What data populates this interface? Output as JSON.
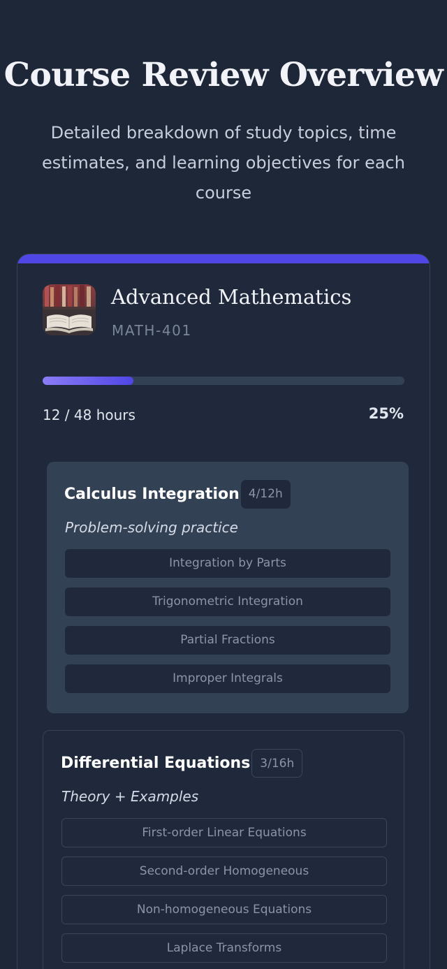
{
  "header": {
    "title": "Course Review Overview",
    "subtitle": "Detailed breakdown of study topics, time estimates, and learning objectives for each course"
  },
  "course": {
    "name": "Advanced Mathematics",
    "code": "MATH-401",
    "thumbnail_icon": "open-book-photo",
    "progress_fraction": 0.25,
    "hours_label": "12 / 48 hours",
    "percent_label": "25%",
    "accent_color": "#5046e5"
  },
  "topics": [
    {
      "title": "Calculus Integration",
      "badge": "4/12h",
      "description": "Problem-solving practice",
      "subtopics": [
        "Integration by Parts",
        "Trigonometric Integration",
        "Partial Fractions",
        "Improper Integrals"
      ]
    },
    {
      "title": "Differential Equations",
      "badge": "3/16h",
      "description": "Theory + Examples",
      "subtopics": [
        "First-order Linear Equations",
        "Second-order Homogeneous",
        "Non-homogeneous Equations",
        "Laplace Transforms"
      ]
    }
  ]
}
